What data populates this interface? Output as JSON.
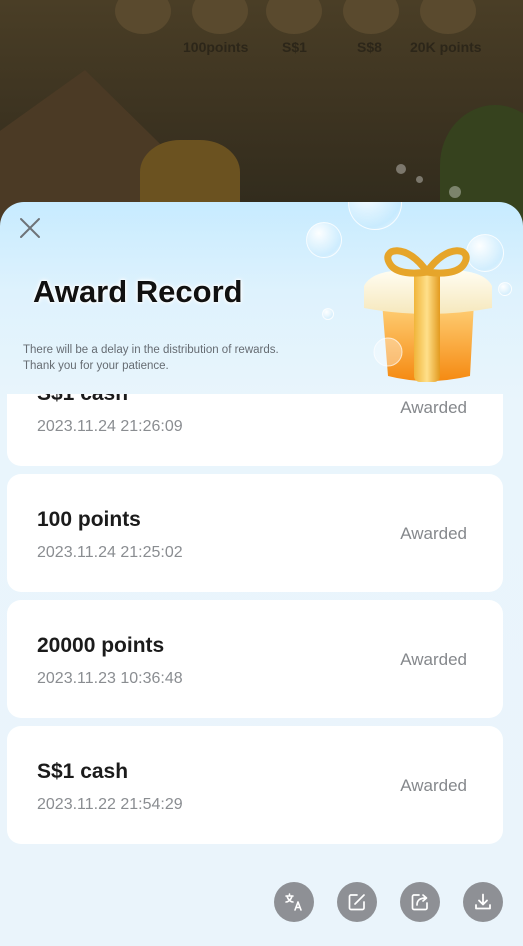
{
  "background": {
    "prize_labels": [
      "100points",
      "S$1",
      "S$8",
      "20K points"
    ]
  },
  "header": {
    "title": "Award Record",
    "notice_line1": "There will be a delay in the distribution of rewards.",
    "notice_line2": "Thank you for your patience.",
    "close_icon": "close-icon",
    "gift_icon": "gift-box-icon"
  },
  "records": [
    {
      "name": "S$1 cash",
      "time": "2023.11.24 21:26:09",
      "status": "Awarded"
    },
    {
      "name": "100 points",
      "time": "2023.11.24 21:25:02",
      "status": "Awarded"
    },
    {
      "name": "20000 points",
      "time": "2023.11.23 10:36:48",
      "status": "Awarded"
    },
    {
      "name": "S$1 cash",
      "time": "2023.11.22 21:54:29",
      "status": "Awarded"
    }
  ],
  "tools": [
    {
      "icon": "translate-icon"
    },
    {
      "icon": "edit-icon"
    },
    {
      "icon": "share-icon"
    },
    {
      "icon": "download-icon"
    }
  ],
  "colors": {
    "sheet_top": "#c7ebff",
    "sheet_bottom": "#eaf4fb",
    "card": "#ffffff",
    "tool_button": "#8e9095"
  }
}
